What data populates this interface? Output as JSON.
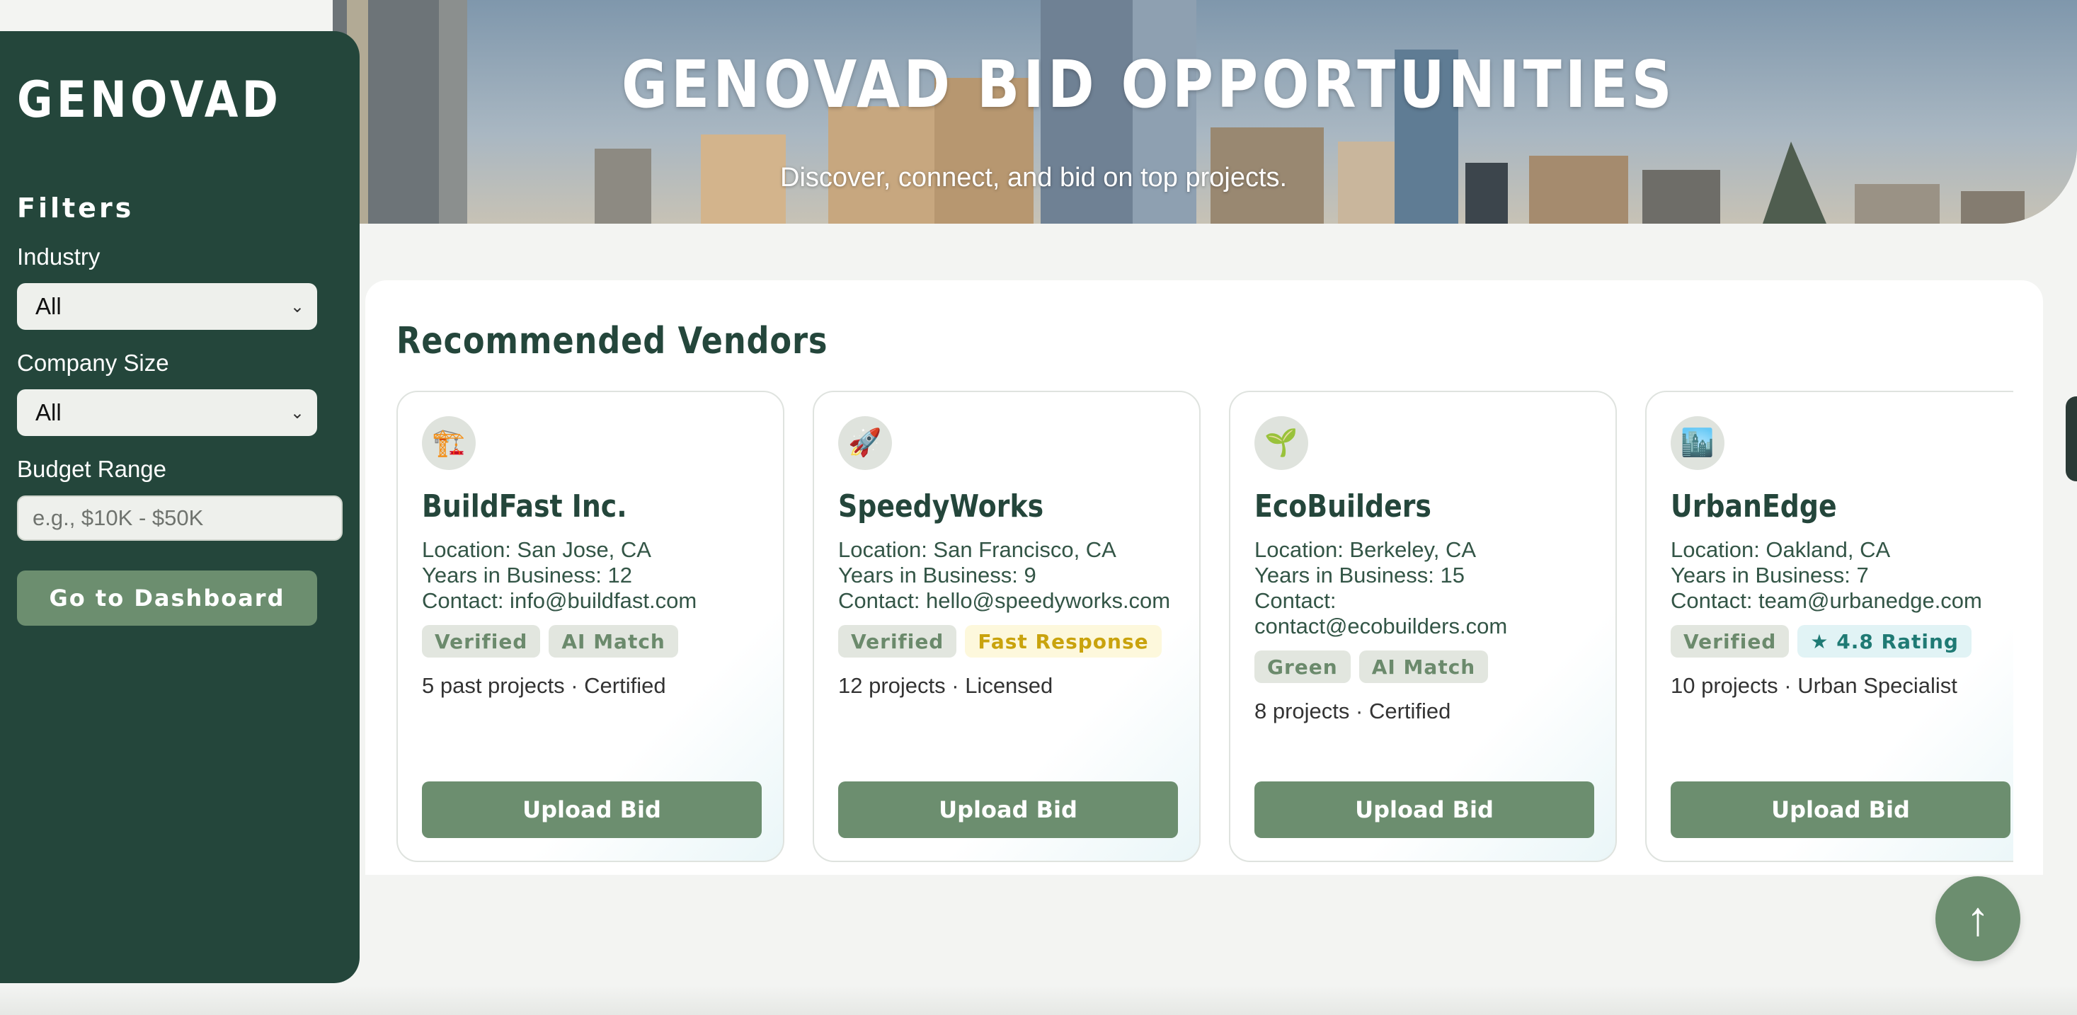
{
  "hero": {
    "title": "GENOVAD BID OPPORTUNITIES",
    "subtitle": "Discover, connect, and bid on top projects."
  },
  "sidebar": {
    "brand": "GENOVAD",
    "filters_title": "Filters",
    "industry_label": "Industry",
    "industry_value": "All",
    "company_size_label": "Company Size",
    "company_size_value": "All",
    "budget_label": "Budget Range",
    "budget_placeholder": "e.g., $10K - $50K",
    "dashboard_button": "Go to Dashboard"
  },
  "main": {
    "section_title": "Recommended Vendors",
    "vendors": [
      {
        "icon": "🏗️",
        "name": "BuildFast Inc.",
        "location": "Location: San Jose, CA",
        "years": "Years in Business: 12",
        "contact": "Contact: info@buildfast.com",
        "badges": [
          {
            "label": "Verified",
            "style": "green"
          },
          {
            "label": "AI Match",
            "style": "green"
          }
        ],
        "meta": "5 past projects · Certified",
        "button": "Upload Bid"
      },
      {
        "icon": "🚀",
        "name": "SpeedyWorks",
        "location": "Location: San Francisco, CA",
        "years": "Years in Business: 9",
        "contact": "Contact: hello@speedyworks.com",
        "badges": [
          {
            "label": "Verified",
            "style": "green"
          },
          {
            "label": "Fast Response",
            "style": "yellow"
          }
        ],
        "meta": "12 projects · Licensed",
        "button": "Upload Bid"
      },
      {
        "icon": "🌱",
        "name": "EcoBuilders",
        "location": "Location: Berkeley, CA",
        "years": "Years in Business: 15",
        "contact": "Contact: contact@ecobuilders.com",
        "badges": [
          {
            "label": "Green",
            "style": "green"
          },
          {
            "label": "AI Match",
            "style": "green"
          }
        ],
        "meta": "8 projects · Certified",
        "button": "Upload Bid"
      },
      {
        "icon": "🏙️",
        "name": "UrbanEdge",
        "location": "Location: Oakland, CA",
        "years": "Years in Business: 7",
        "contact": "Contact: team@urbanedge.com",
        "badges": [
          {
            "label": "Verified",
            "style": "green"
          },
          {
            "label": "★ 4.8 Rating",
            "style": "teal"
          }
        ],
        "meta": "10 projects · Urban Specialist",
        "button": "Upload Bid"
      }
    ]
  },
  "scroll_top_icon": "arrow-up-icon",
  "scroll_top_glyph": "↑",
  "colors": {
    "sidebar": "#24463b",
    "accent": "#6c8e6f",
    "heading": "#24463b"
  }
}
